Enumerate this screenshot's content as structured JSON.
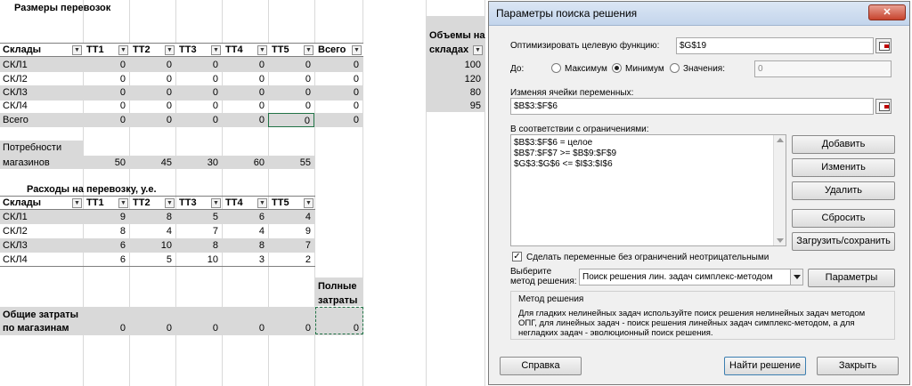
{
  "sheet": {
    "title_sizes": "Размеры перевозок",
    "hdr_sklady": "Склады",
    "cols": [
      "ТТ1",
      "ТТ2",
      "ТТ3",
      "ТТ4",
      "ТТ5"
    ],
    "hdr_total": "Всего",
    "volumes_label_1": "Объемы на",
    "volumes_label_2": "складах",
    "rows": [
      {
        "name": "СКЛ1",
        "vals": [
          "0",
          "0",
          "0",
          "0",
          "0"
        ],
        "total": "0",
        "volume": "100"
      },
      {
        "name": "СКЛ2",
        "vals": [
          "0",
          "0",
          "0",
          "0",
          "0"
        ],
        "total": "0",
        "volume": "120"
      },
      {
        "name": "СКЛ3",
        "vals": [
          "0",
          "0",
          "0",
          "0",
          "0"
        ],
        "total": "0",
        "volume": "80"
      },
      {
        "name": "СКЛ4",
        "vals": [
          "0",
          "0",
          "0",
          "0",
          "0"
        ],
        "total": "0",
        "volume": "95"
      }
    ],
    "total_row": {
      "name": "Всего",
      "vals": [
        "0",
        "0",
        "0",
        "0",
        "0"
      ],
      "total": "0"
    },
    "demand_label_1": "Потребности",
    "demand_label_2": "магазинов",
    "demand": [
      "50",
      "45",
      "30",
      "60",
      "55"
    ],
    "title_costs": "Расходы на перевозку, у.е.",
    "cost_rows": [
      {
        "name": "СКЛ1",
        "vals": [
          "9",
          "8",
          "5",
          "6",
          "4"
        ]
      },
      {
        "name": "СКЛ2",
        "vals": [
          "8",
          "4",
          "7",
          "4",
          "9"
        ]
      },
      {
        "name": "СКЛ3",
        "vals": [
          "6",
          "10",
          "8",
          "8",
          "7"
        ]
      },
      {
        "name": "СКЛ4",
        "vals": [
          "6",
          "5",
          "10",
          "3",
          "2"
        ]
      }
    ],
    "full_costs_1": "Полные",
    "full_costs_2": "затраты",
    "total_costs_1": "Общие затраты",
    "total_costs_2": "по магазинам",
    "total_costs": [
      "0",
      "0",
      "0",
      "0",
      "0"
    ],
    "full_costs_value": "0",
    "filter_icon": "dropdown-filter-icon"
  },
  "dialog": {
    "title": "Параметры поиска решения",
    "close_label": "✕",
    "objective_label": "Оптимизировать целевую функцию:",
    "objective_value": "$G$19",
    "to_label": "До:",
    "radio_max": "Максимум",
    "radio_min": "Минимум",
    "radio_value": "Значения:",
    "value_field": "0",
    "selected": "Минимум",
    "changing_label": "Изменяя ячейки переменных:",
    "changing_value": "$B$3:$F$6",
    "constraints_label": "В соответствии с ограничениями:",
    "constraints": [
      "$B$3:$F$6 = целое",
      "$B$7:$F$7 >= $B$9:$F$9",
      "$G$3:$G$6 <= $I$3:$I$6"
    ],
    "btn_add": "Добавить",
    "btn_change": "Изменить",
    "btn_delete": "Удалить",
    "btn_reset": "Сбросить",
    "btn_load": "Загрузить/сохранить",
    "nonneg_label": "Сделать переменные без ограничений неотрицательными",
    "nonneg_checked": true,
    "method_label_1": "Выберите",
    "method_label_2": "метод решения:",
    "method_value": "Поиск решения лин. задач симплекс-методом",
    "btn_params": "Параметры",
    "method_group": "Метод решения",
    "method_desc": "Для гладких нелинейных задач используйте поиск решения нелинейных задач методом ОПГ, для линейных задач - поиск решения линейных задач симплекс-методом, а для негладких задач - эволюционный поиск решения.",
    "btn_help": "Справка",
    "btn_solve": "Найти решение",
    "btn_close": "Закрыть"
  }
}
